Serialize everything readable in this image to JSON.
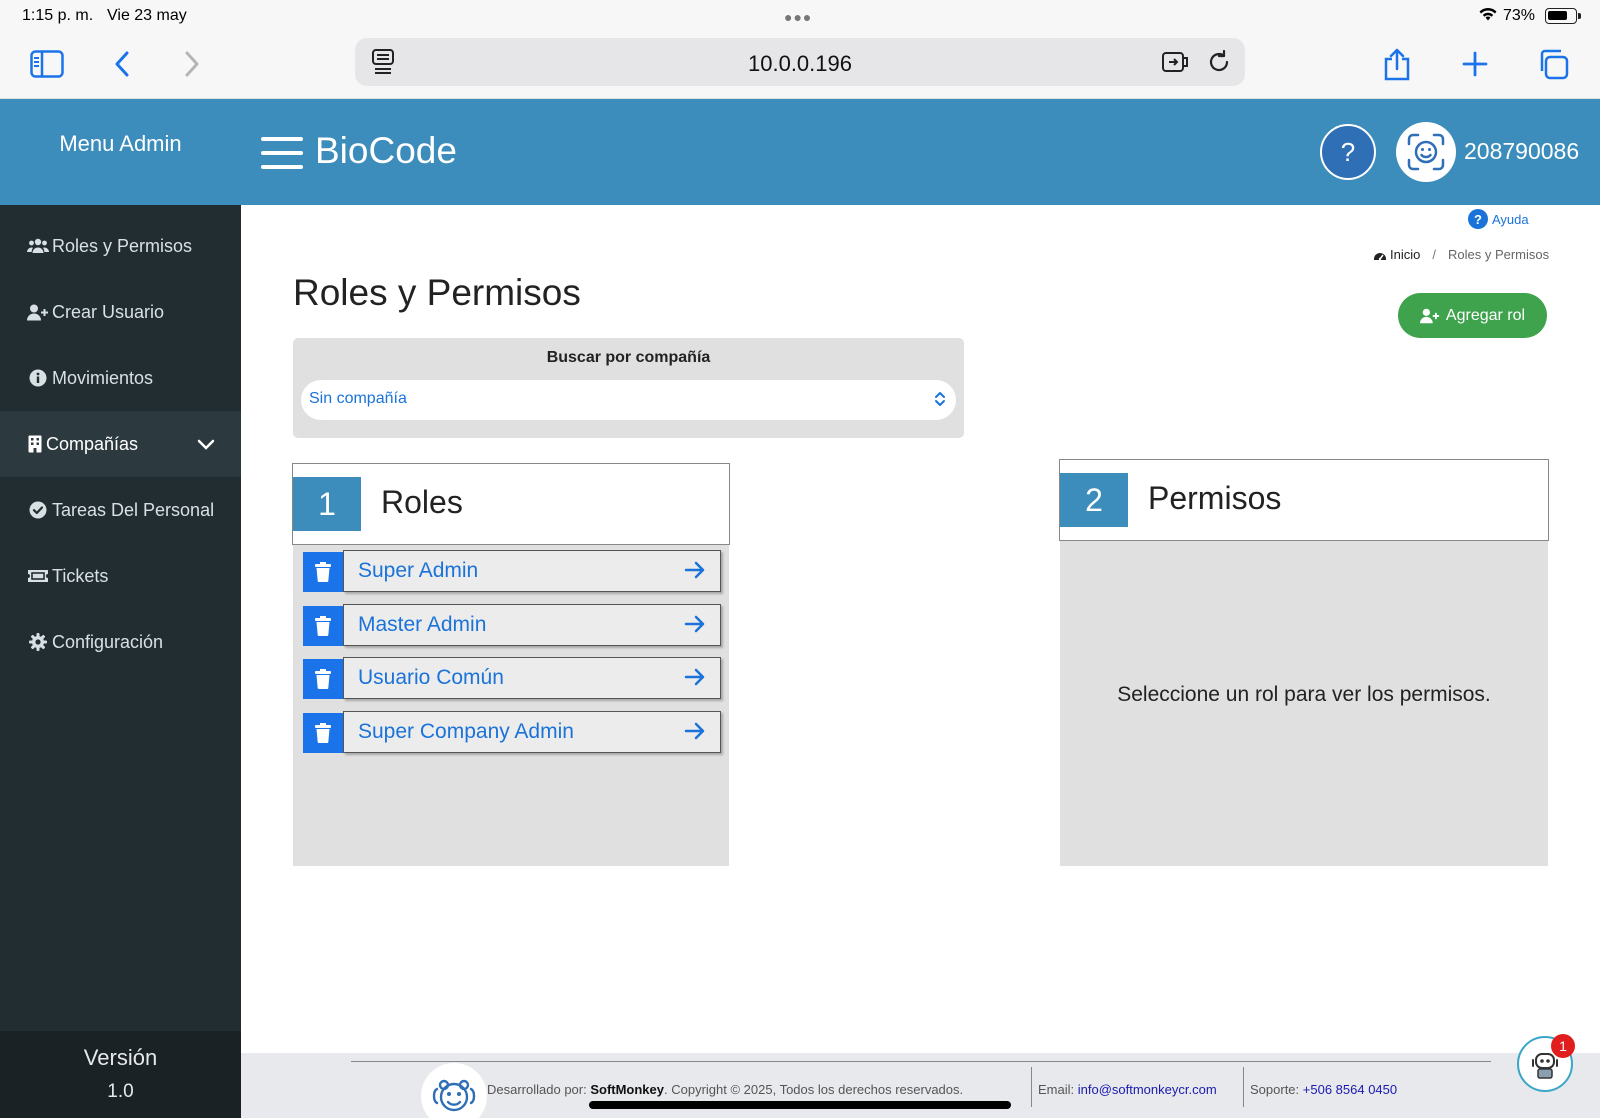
{
  "status_bar": {
    "time": "1:15 p. m.",
    "date": "Vie 23 may",
    "battery_pct": "73%",
    "battery_level": 0.73
  },
  "browser": {
    "url": "10.0.0.196",
    "icons": [
      "sidebar-toggle-icon",
      "back-icon",
      "forward-icon",
      "reader-icon",
      "extension-icon",
      "reload-icon",
      "share-icon",
      "new-tab-icon",
      "tabs-icon"
    ]
  },
  "sidebar": {
    "title": "Menu Admin",
    "items": [
      {
        "label": "Roles y Permisos",
        "icon": "users-icon"
      },
      {
        "label": "Crear Usuario",
        "icon": "user-plus-icon"
      },
      {
        "label": "Movimientos",
        "icon": "info-icon"
      },
      {
        "label": "Compañías",
        "icon": "building-icon",
        "expanded": true
      },
      {
        "label": "Tareas Del Personal",
        "icon": "check-circle-icon"
      },
      {
        "label": "Tickets",
        "icon": "ticket-icon"
      },
      {
        "label": "Configuración",
        "icon": "gear-icon"
      }
    ],
    "version_label": "Versión",
    "version": "1.0"
  },
  "header": {
    "brand": "BioCode",
    "help": "?",
    "user_id": "208790086"
  },
  "content": {
    "help_link": "Ayuda",
    "breadcrumb": {
      "home": "Inicio",
      "sep": "/",
      "current": "Roles y Permisos"
    },
    "title": "Roles y Permisos",
    "add_role_label": "Agregar rol",
    "search": {
      "label": "Buscar por compañía",
      "selected": "Sin compañía"
    },
    "roles_panel": {
      "number": "1",
      "title": "Roles"
    },
    "roles": [
      "Super Admin",
      "Master Admin",
      "Usuario Común",
      "Super Company Admin"
    ],
    "permissions_panel": {
      "number": "2",
      "title": "Permisos",
      "empty_message": "Seleccione un rol para ver los permisos."
    }
  },
  "footer": {
    "dev_prefix": "Desarrollado por: ",
    "company": "SoftMonkey",
    "copyright": ". Copyright © 2025, Todos los derechos reservados.",
    "email_label": "Email: ",
    "email": "info@softmonkeycr.com",
    "support_label": "Soporte: ",
    "phone": "+506 8564 0450"
  },
  "chat": {
    "badge_count": "1"
  },
  "colors": {
    "primary": "#3c8dbc",
    "sidebar": "#222d32",
    "success": "#3fa34d",
    "link": "#1a73d9",
    "danger": "#e01e1e"
  }
}
